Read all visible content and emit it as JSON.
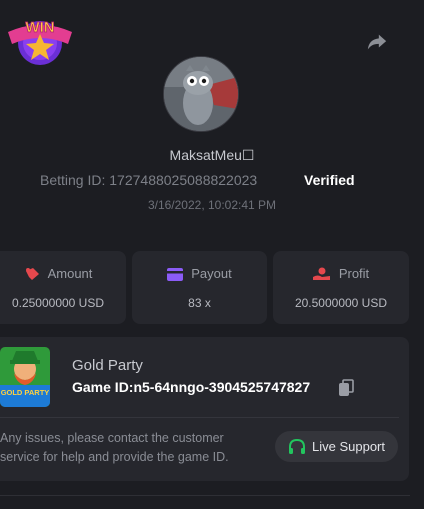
{
  "header": {
    "badge_text": "WIN",
    "share_icon": "share-icon"
  },
  "profile": {
    "username": "MaksatMeu☐",
    "betting_id_label": "Betting ID:",
    "betting_id": "1727488025088822023",
    "verified": "Verified",
    "datetime": "3/16/2022, 10:02:41 PM"
  },
  "stats": [
    {
      "label": "Amount",
      "value": "0.25000000 USD",
      "icon": "amount-icon",
      "color": "#e5484d"
    },
    {
      "label": "Payout",
      "value": "83 x",
      "icon": "payout-card-icon",
      "color": "#8b5cf6"
    },
    {
      "label": "Profit",
      "value": "20.5000000 USD",
      "icon": "profit-hand-icon",
      "color": "#e5484d"
    }
  ],
  "game": {
    "name": "Gold Party",
    "thumb_text": "GOLD PARTY",
    "id_label": "Game ID:",
    "id_value": "n5-64nngo-3904525747827",
    "notice": "Any issues, please contact the customer service for help and provide the game ID.",
    "support_label": "Live Support",
    "support_icon": "headset-icon",
    "support_color": "#22c55e"
  }
}
